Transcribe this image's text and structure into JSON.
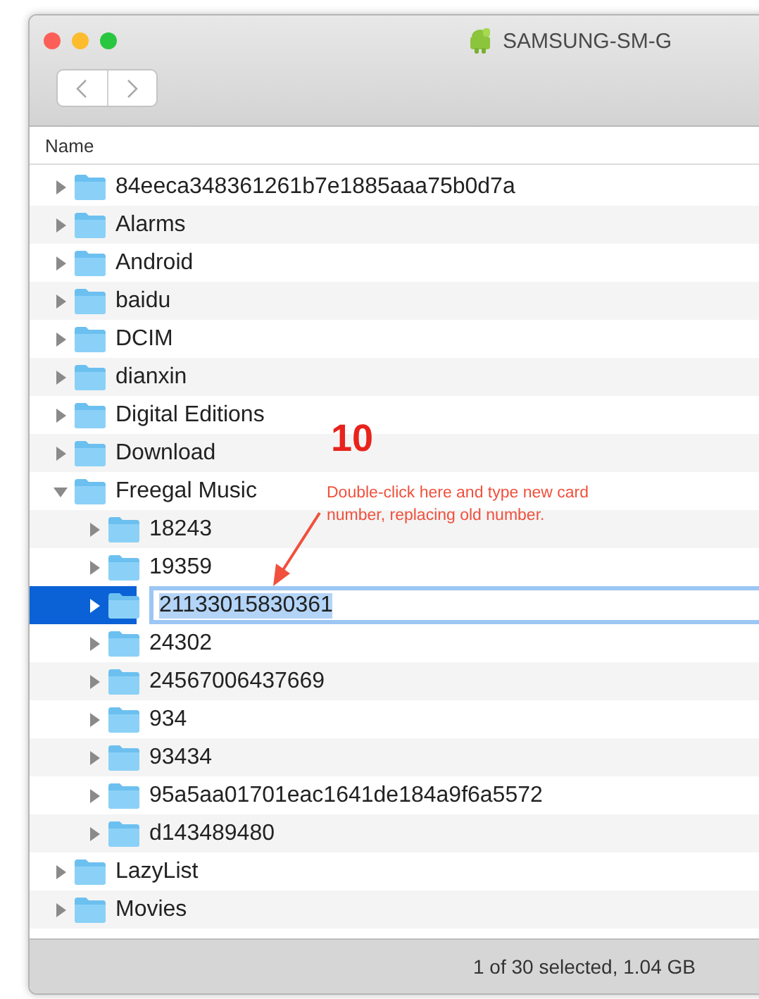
{
  "window": {
    "title": "SAMSUNG-SM-G"
  },
  "table": {
    "columns": [
      "Name"
    ],
    "rows": [
      {
        "name": "84eeca348361261b7e1885aaa75b0d7a",
        "expanded": false,
        "selected": false
      },
      {
        "name": "Alarms",
        "expanded": false,
        "selected": false
      },
      {
        "name": "Android",
        "expanded": false,
        "selected": false
      },
      {
        "name": "baidu",
        "expanded": false,
        "selected": false
      },
      {
        "name": "DCIM",
        "expanded": false,
        "selected": false
      },
      {
        "name": "dianxin",
        "expanded": false,
        "selected": false
      },
      {
        "name": "Digital Editions",
        "expanded": false,
        "selected": false
      },
      {
        "name": "Download",
        "expanded": false,
        "selected": false
      },
      {
        "name": "Freegal Music",
        "expanded": true,
        "selected": false,
        "children": [
          {
            "name": "18243",
            "expanded": false,
            "selected": false
          },
          {
            "name": "19359",
            "expanded": false,
            "selected": false
          },
          {
            "name": "21133015830361",
            "expanded": false,
            "selected": true,
            "editing": true
          },
          {
            "name": "24302",
            "expanded": false,
            "selected": false
          },
          {
            "name": "24567006437669",
            "expanded": false,
            "selected": false
          },
          {
            "name": "934",
            "expanded": false,
            "selected": false
          },
          {
            "name": "93434",
            "expanded": false,
            "selected": false
          },
          {
            "name": "95a5aa01701eac1641de184a9f6a5572",
            "expanded": false,
            "selected": false
          },
          {
            "name": "d143489480",
            "expanded": false,
            "selected": false
          }
        ]
      },
      {
        "name": "LazyList",
        "expanded": false,
        "selected": false
      },
      {
        "name": "Movies",
        "expanded": false,
        "selected": false
      }
    ]
  },
  "status_bar": "1 of 30 selected, 1.04 GB",
  "annotation": {
    "step": "10",
    "note": "Double-click here and type new card number, replacing old number."
  }
}
